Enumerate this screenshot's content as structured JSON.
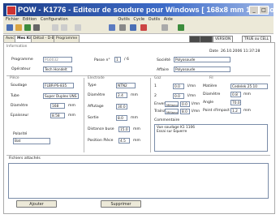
{
  "window": {
    "title": "POW - K1776 - Editeur de soudure pour Windows  [ 168x8 mm 12CrMoV ]"
  },
  "menu": [
    "Fichier",
    "Edition",
    "Configuration",
    "Outils",
    "Cycle",
    "Outils",
    "Aide"
  ],
  "tabs": [
    "Avec",
    "Mes Kits",
    "Détail - D-BV",
    "Programme"
  ],
  "right_pills": [
    "VERSION",
    "TRUE ou CELL"
  ],
  "header": {
    "section_label": "Information",
    "programme_label": "Programme",
    "programme_value": "PG0032",
    "passe_label": "Passe n°",
    "passe_value": "1",
    "passe_of": "/ 6",
    "date_label": "Date",
    "date_value": "26.10.2006 11:37:28",
    "operateur_label": "Opérateur",
    "operateur_value": "Tech Hondelt",
    "societe_label": "Société",
    "societe_value": "Polyosoude",
    "affaire_label": "Affaire",
    "affaire_value": "Polyosoude"
  },
  "left": {
    "section": "Pièce",
    "rows": [
      {
        "label": "Soudage",
        "value": "FLBR-PS-835"
      },
      {
        "label": "Tube",
        "value": "Super Duplex UNS"
      },
      {
        "label": "Diamètre",
        "value": "168",
        "unit": "mm"
      },
      {
        "label": "Epaisseur",
        "value": "8.58",
        "unit": "mm"
      }
    ],
    "polarite_label": "Polarité",
    "polarite_value": "Bat"
  },
  "middle": {
    "section": "Electrode",
    "rows": [
      {
        "label": "Type",
        "value": "NTN2"
      },
      {
        "label": "Diamètre",
        "value": "2.4",
        "unit": "mm"
      },
      {
        "label": "Affutage",
        "value": "30.0"
      },
      {
        "label": "Sortie",
        "value": "8.0",
        "unit": "mm"
      },
      {
        "label": "Distance buse",
        "value": "15.0",
        "unit": "mm"
      },
      {
        "label": "Position Pièce",
        "value": "4.5",
        "unit": "mm"
      }
    ]
  },
  "right": {
    "section": "Gaz",
    "section2": "Fil",
    "gaz_rows": [
      {
        "label": "1",
        "value": "0.0",
        "unit": "l/mn"
      },
      {
        "label": "2",
        "value": "0.0",
        "unit": "l/mn"
      },
      {
        "label": "Envers",
        "gas": "Mélanges",
        "value": "0.0",
        "unit": "l/mn"
      },
      {
        "label": "Traînard",
        "gas": "Mélanges",
        "value": "8.0",
        "unit": "l/mn"
      }
    ],
    "fil_rows": [
      {
        "label": "Matière",
        "value": "Cedelek 25 10"
      },
      {
        "label": "Diamètre",
        "value": "0.8",
        "unit": "mm"
      },
      {
        "label": "Angle",
        "value": "70.0"
      },
      {
        "label": "Point d'Impact",
        "value": "1.2",
        "unit": "mm"
      }
    ],
    "commentaire_label": "Commentaire",
    "commentaire_lines": [
      "Vue soudage K1 1106",
      "Essai sur Equerre"
    ]
  },
  "footer": {
    "fichiers_label": "Fichiers attachés",
    "add_button": "Ajouter",
    "delete_button": "Supprimer"
  }
}
